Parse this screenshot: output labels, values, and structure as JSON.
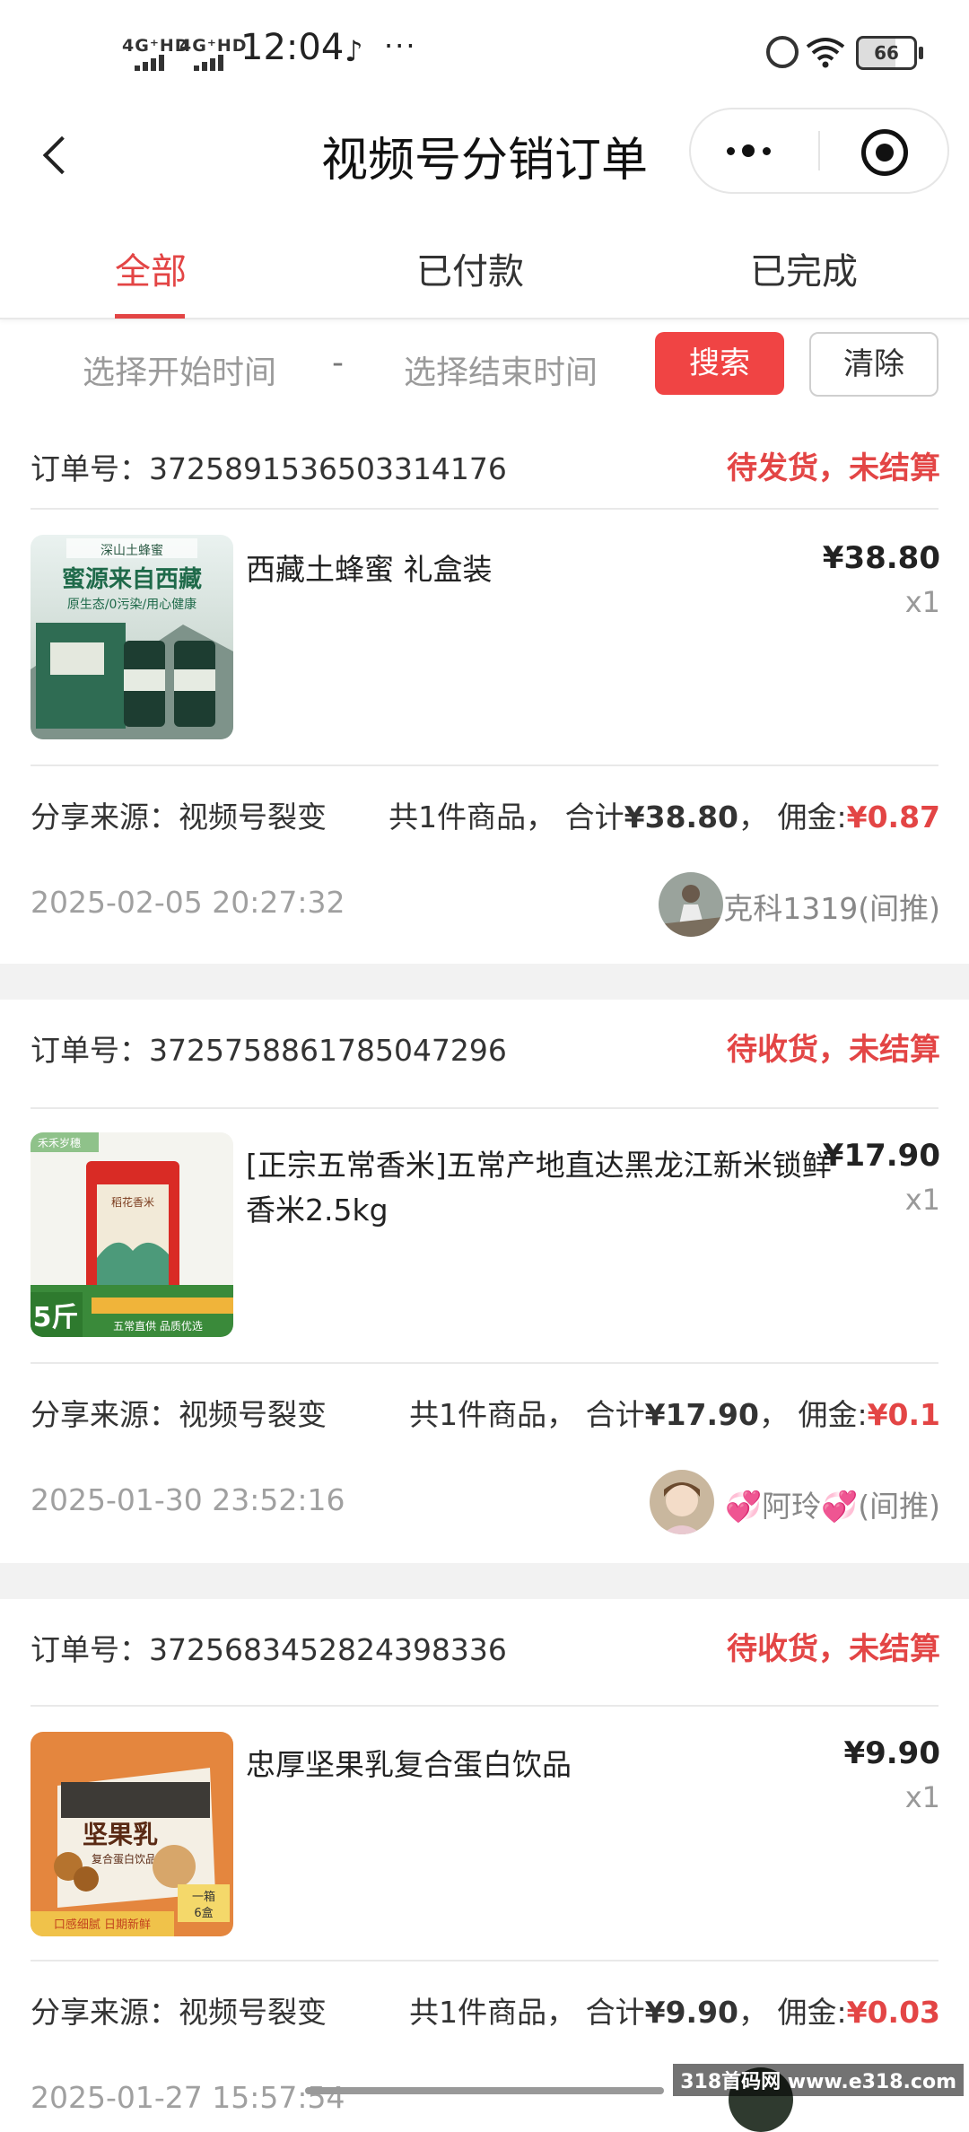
{
  "status_bar": {
    "net1": "4G⁺HD",
    "net2": "4G⁺HD",
    "time": "12:04",
    "battery": "66",
    "icons": [
      "tiktok-icon",
      "more-dots-icon",
      "alarm-icon",
      "wifi-icon",
      "battery-icon"
    ]
  },
  "nav": {
    "title": "视频号分销订单",
    "icons": [
      "back-chevron-icon",
      "more-menu-icon",
      "close-target-icon"
    ]
  },
  "tabs": [
    {
      "label": "全部",
      "active": true
    },
    {
      "label": "已付款",
      "active": false
    },
    {
      "label": "已完成",
      "active": false
    }
  ],
  "filter": {
    "start_placeholder": "选择开始时间",
    "separator": "-",
    "end_placeholder": "选择结束时间",
    "search_label": "搜索",
    "clear_label": "清除"
  },
  "colors": {
    "accent_red": "#e34545",
    "button_red": "#f04444",
    "divider": "#e9e9e9",
    "section_gap": "#f2f2f2"
  },
  "orders": [
    {
      "order_no_label": "订单号：",
      "order_no": "3725891536503314176",
      "status": "待发货，未结算",
      "product_title": "西藏土蜂蜜 礼盒装",
      "price": "¥38.80",
      "qty": "x1",
      "source": "分享来源：视频号裂变",
      "summary_prefix": "共1件商品， 合计",
      "total": "¥38.80",
      "commission_label": "， 佣金:",
      "commission": "¥0.87",
      "time": "2025-02-05 20:27:32",
      "user": "克科1319(间推)",
      "thumb_text": [
        "深山土蜂蜜",
        "蜜源来自西藏",
        "原生态/0污染/用心健康"
      ]
    },
    {
      "order_no_label": "订单号：",
      "order_no": "3725758861785047296",
      "status": "待收货，未结算",
      "product_title": "[正宗五常香米]五常产地直达黑龙江新米锁鲜香米2.5kg",
      "price": "¥17.90",
      "qty": "x1",
      "source": "分享来源：视频号裂变",
      "summary_prefix": "共1件商品， 合计",
      "total": "¥17.90",
      "commission_label": "， 佣金:",
      "commission": "¥0.1",
      "time": "2025-01-30 23:52:16",
      "user": "💞阿玲💞(间推)",
      "thumb_text": [
        "禾禾岁穗",
        "稻花香米",
        "5斤",
        "五常直供 品质优选"
      ]
    },
    {
      "order_no_label": "订单号：",
      "order_no": "3725683452824398336",
      "status": "待收货，未结算",
      "product_title": "忠厚坚果乳复合蛋白饮品",
      "price": "¥9.90",
      "qty": "x1",
      "source": "分享来源：视频号裂变",
      "summary_prefix": "共1件商品， 合计",
      "total": "¥9.90",
      "commission_label": "， 佣金:",
      "commission": "¥0.03",
      "time": "2025-01-27 15:57:54",
      "user": "",
      "thumb_text": [
        "坚果乳",
        "复合蛋白饮品",
        "一箱",
        "6盒",
        "口感细腻 日期新鲜"
      ]
    }
  ],
  "watermark": "318首码网 www.e318.com"
}
